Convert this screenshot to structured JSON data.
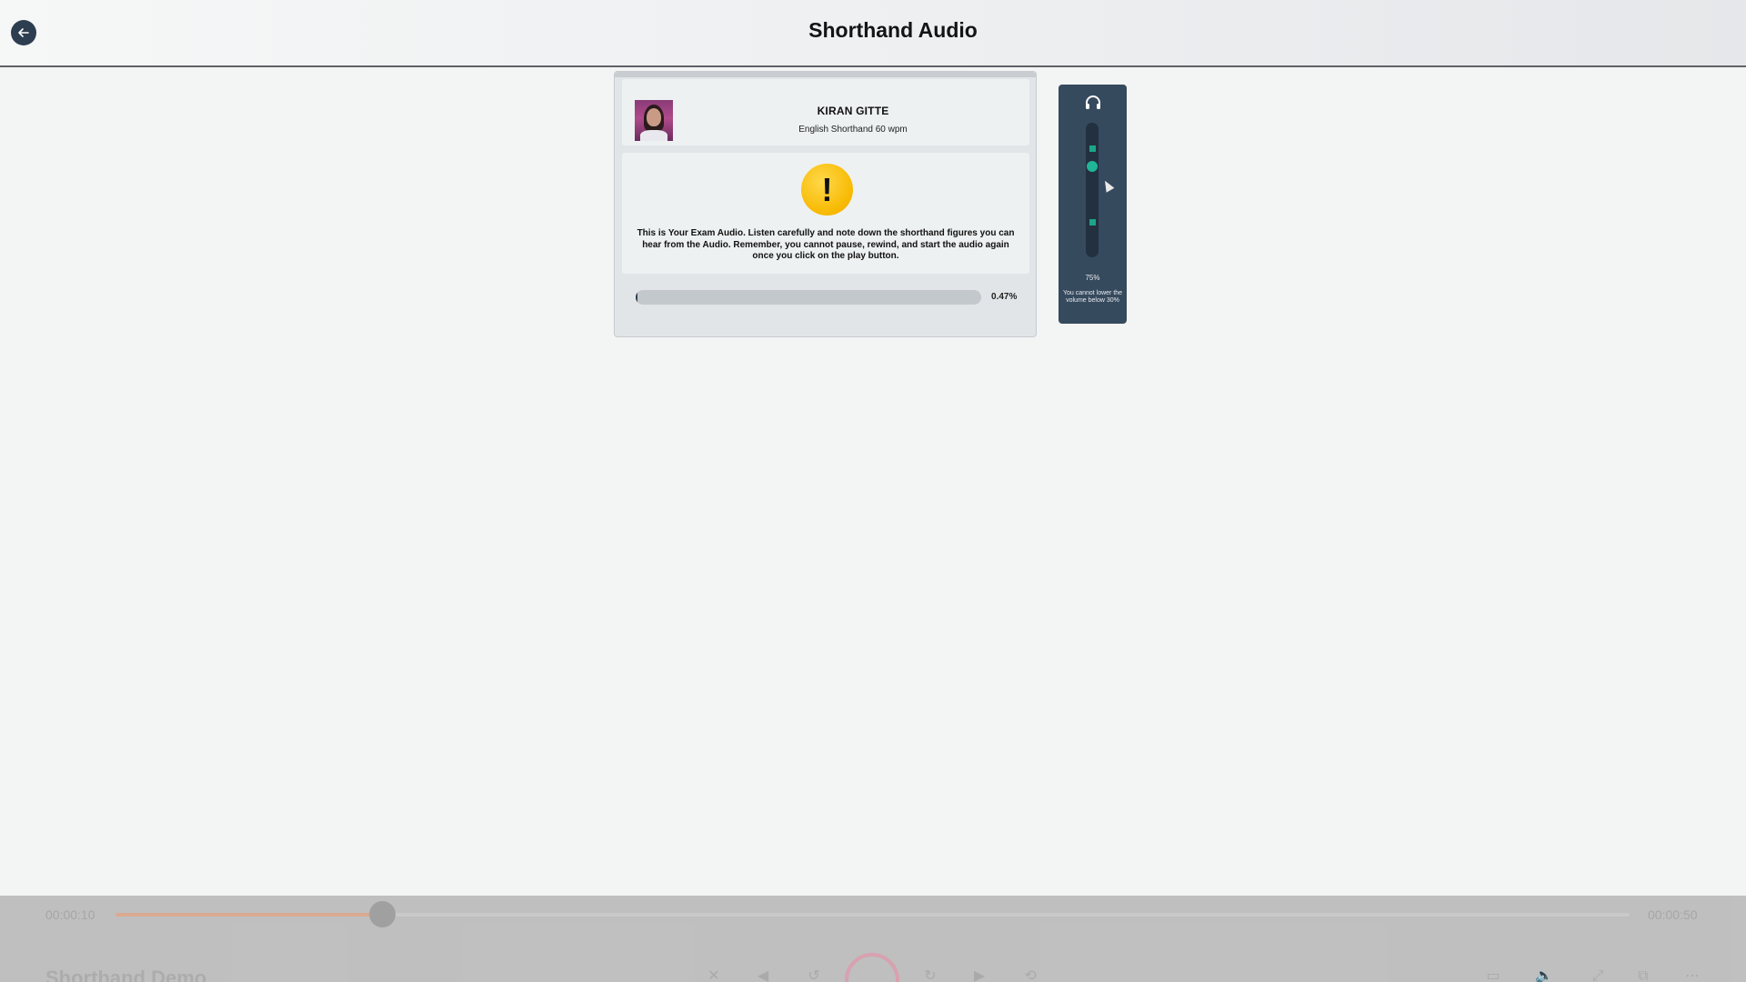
{
  "header": {
    "title": "Shorthand Audio"
  },
  "profile": {
    "name": "KIRAN GITTE",
    "course": "English Shorthand 60 wpm"
  },
  "warning": {
    "message": "This is Your Exam Audio. Listen carefully and note down the shorthand figures you can hear from the Audio. Remember, you cannot pause, rewind, and start the audio again once you click on the play button."
  },
  "progress": {
    "value": 0.47,
    "label": "0.47%"
  },
  "volume": {
    "value": 75,
    "label": "75%",
    "min_value": 30,
    "note": "You cannot lower the volume below 30%"
  },
  "player": {
    "current_time": "00:00:10",
    "total_time": "00:00:50",
    "position_fraction": 0.176,
    "track_title": "Shorthand Demo"
  },
  "colors": {
    "accent": "#2d3e50",
    "volume_accent": "#1fb596",
    "warning": "#f7b900"
  }
}
